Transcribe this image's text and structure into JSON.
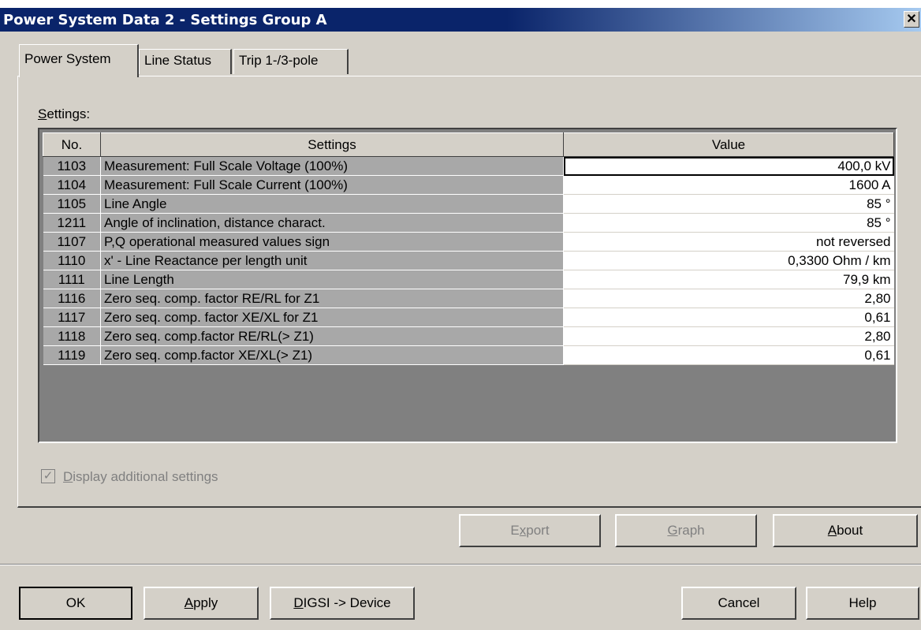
{
  "window": {
    "title": "Power System Data 2 - Settings Group A",
    "close": "✕"
  },
  "tabs": [
    "Power System",
    "Line Status",
    "Trip 1-/3-pole"
  ],
  "settings_label": {
    "mnemonic": "S",
    "rest": "ettings:"
  },
  "table": {
    "headers": [
      "No.",
      "Settings",
      "Value"
    ],
    "rows": [
      [
        "1103",
        "Measurement: Full Scale Voltage (100%)",
        "400,0 kV"
      ],
      [
        "1104",
        "Measurement: Full Scale Current (100%)",
        "1600 A"
      ],
      [
        "1105",
        "Line Angle",
        "85 °"
      ],
      [
        "1211",
        "Angle of inclination, distance charact.",
        "85 °"
      ],
      [
        "1107",
        "P,Q operational measured values sign",
        "not reversed"
      ],
      [
        "1110",
        "x' - Line Reactance per length unit",
        "0,3300 Ohm / km"
      ],
      [
        "1111",
        "Line Length",
        "79,9 km"
      ],
      [
        "1116",
        "Zero seq. comp. factor RE/RL for Z1",
        "2,80"
      ],
      [
        "1117",
        "Zero seq. comp. factor XE/XL for Z1",
        "0,61"
      ],
      [
        "1118",
        "Zero seq. comp.factor RE/RL(> Z1)",
        "2,80"
      ],
      [
        "1119",
        "Zero seq. comp.factor XE/XL(> Z1)",
        "0,61"
      ]
    ]
  },
  "checkbox": {
    "mnemonic": "D",
    "rest": "isplay additional settings",
    "checked": true,
    "mark": "✓"
  },
  "panel_buttons": {
    "export": {
      "pre": "E",
      "mnemonic": "x",
      "post": "port"
    },
    "graph": {
      "pre": "",
      "mnemonic": "G",
      "post": "raph"
    },
    "about": {
      "pre": "",
      "mnemonic": "A",
      "post": "bout"
    }
  },
  "dialog_buttons": {
    "ok": "OK",
    "apply": {
      "pre": "",
      "mnemonic": "A",
      "post": "pply"
    },
    "digsi": {
      "pre": "",
      "mnemonic": "D",
      "post": "IGSI -> Device"
    },
    "cancel": "Cancel",
    "help": "Help"
  }
}
